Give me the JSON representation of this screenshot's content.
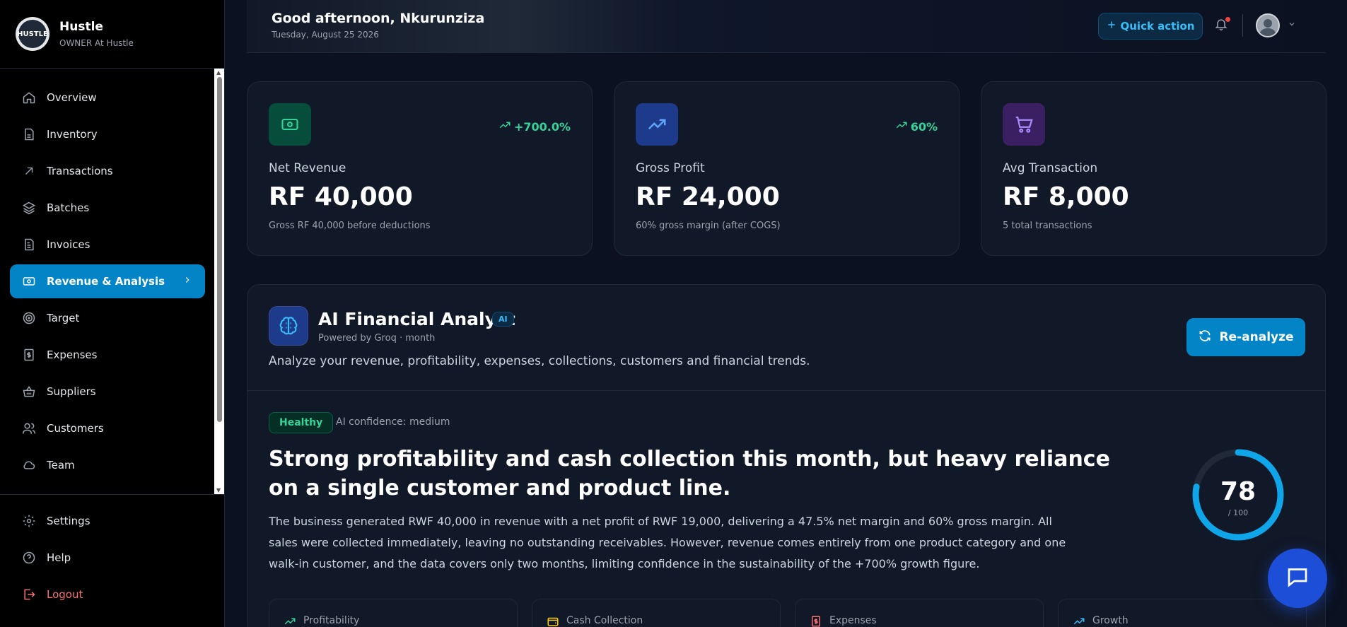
{
  "sidebar": {
    "brand_name": "Hustle",
    "brand_role": "OWNER At Hustle",
    "logo_text": "HUSTLE",
    "items": [
      {
        "label": "Overview",
        "icon": "home-icon"
      },
      {
        "label": "Inventory",
        "icon": "file-icon"
      },
      {
        "label": "Transactions",
        "icon": "arrow-up-right-icon"
      },
      {
        "label": "Batches",
        "icon": "layers-icon"
      },
      {
        "label": "Invoices",
        "icon": "document-icon"
      },
      {
        "label": "Revenue & Analysis",
        "icon": "cash-icon",
        "active": true
      },
      {
        "label": "Target",
        "icon": "target-icon"
      },
      {
        "label": "Expenses",
        "icon": "receipt-icon"
      },
      {
        "label": "Suppliers",
        "icon": "basket-icon"
      },
      {
        "label": "Customers",
        "icon": "users-icon"
      },
      {
        "label": "Team",
        "icon": "cloud-icon"
      }
    ],
    "bottom": [
      {
        "label": "Settings",
        "icon": "gear-icon"
      },
      {
        "label": "Help",
        "icon": "help-icon"
      },
      {
        "label": "Logout",
        "icon": "logout-icon"
      }
    ]
  },
  "header": {
    "greeting": "Good afternoon, Nkurunziza",
    "date": "Tuesday, August 25 2026",
    "quick_action": "Quick action"
  },
  "stats": [
    {
      "label": "Net Revenue",
      "value": "RF 40,000",
      "sub": "Gross RF 40,000 before deductions",
      "trend": "+700.0%",
      "icon": "cash-icon",
      "color": "#34d399"
    },
    {
      "label": "Gross Profit",
      "value": "RF 24,000",
      "sub": "60% gross margin (after COGS)",
      "trend": "60%",
      "icon": "trending-up-icon",
      "color": "#60a5fa"
    },
    {
      "label": "Avg Transaction",
      "value": "RF 8,000",
      "sub": "5 total transactions",
      "trend": "",
      "icon": "cart-icon",
      "color": "#a78bfa"
    }
  ],
  "ai": {
    "title": "AI Financial Analyst",
    "badge": "AI",
    "subtitle": "Powered by Groq · month",
    "description": "Analyze your revenue, profitability, expenses, collections, customers and financial trends.",
    "reanalyze": "Re-analyze",
    "status": "Healthy",
    "confidence": "AI confidence: medium",
    "headline": "Strong profitability and cash collection this month, but heavy reliance on a single customer and product line.",
    "summary": "The business generated RWF 40,000 in revenue with a net profit of RWF 19,000, delivering a 47.5% net margin and 60% gross margin. All sales were collected immediately, leaving no outstanding receivables. However, revenue comes entirely from one product category and one walk-in customer, and the data covers only two months, limiting confidence in the sustainability of the +700% growth figure.",
    "score": "78",
    "score_max": "/ 100",
    "score_value": 78,
    "mini_cards": [
      {
        "label": "Profitability",
        "icon": "trending-up-icon",
        "color": "#34d399"
      },
      {
        "label": "Cash Collection",
        "icon": "wallet-icon",
        "color": "#facc15"
      },
      {
        "label": "Expenses",
        "icon": "receipt-icon",
        "color": "#f87171"
      },
      {
        "label": "Growth",
        "icon": "trending-up-icon",
        "color": "#38bdf8"
      }
    ]
  },
  "colors": {
    "accent": "#0284c7",
    "success": "#34d399",
    "danger": "#ef4444"
  }
}
